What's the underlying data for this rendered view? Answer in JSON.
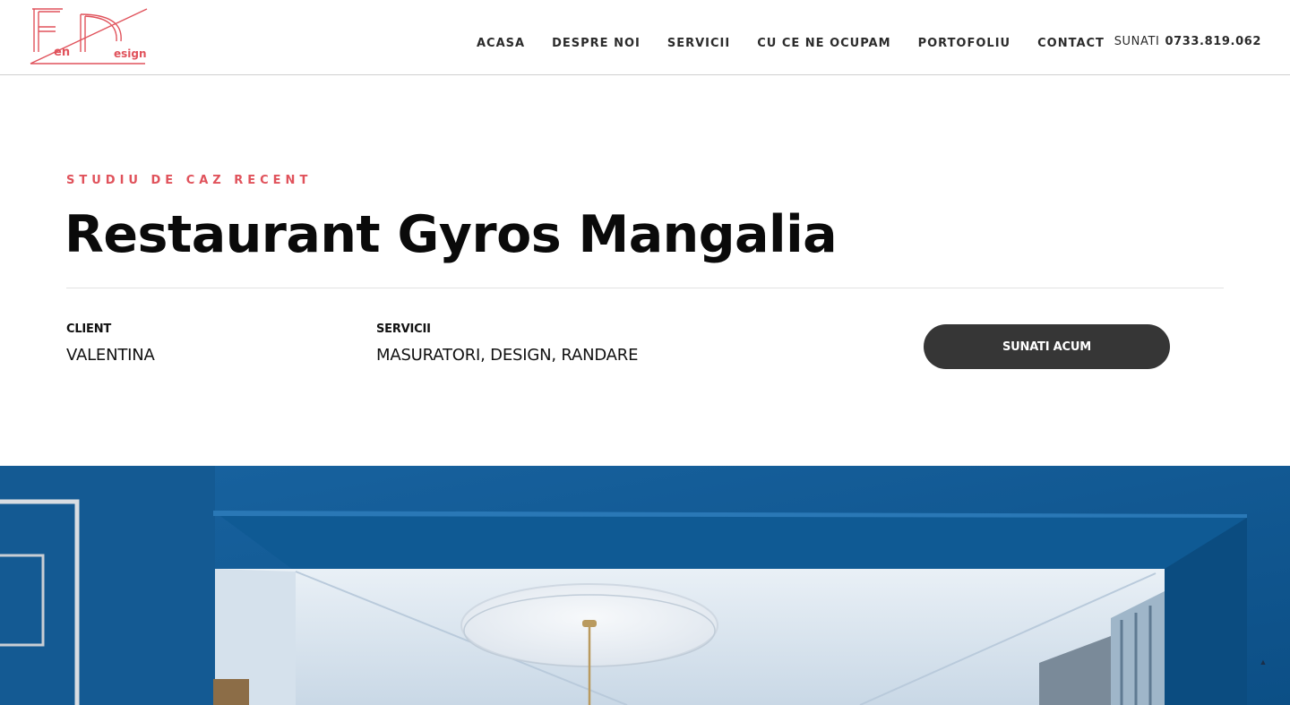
{
  "logo": {
    "alt": "Fen Design",
    "word1": "en",
    "word2": "esign",
    "color": "#e0525b"
  },
  "nav": {
    "items": [
      {
        "label": "ACASA"
      },
      {
        "label": "DESPRE NOI"
      },
      {
        "label": "SERVICII"
      },
      {
        "label": "CU CE NE OCUPAM"
      },
      {
        "label": "PORTOFOLIU"
      },
      {
        "label": "CONTACT"
      }
    ]
  },
  "phone": {
    "prefix": "SUNATI",
    "number": "0733.819.062"
  },
  "case_study": {
    "eyebrow": "STUDIU DE CAZ RECENT",
    "title": "Restaurant Gyros Mangalia",
    "client_label": "CLIENT",
    "client_value": "VALENTINA",
    "services_label": "SERVICII",
    "services_value": "MASURATORI, DESIGN, RANDARE",
    "cta_label": "SUNATI ACUM"
  },
  "hero_image": {
    "alt": "Restaurant interior with blue walls and white ceiling"
  },
  "colors": {
    "accent": "#e0525b",
    "button": "#363636",
    "wall_blue": "#0f5a94"
  },
  "icons": {
    "scroll_top": "arrow-up-icon"
  }
}
